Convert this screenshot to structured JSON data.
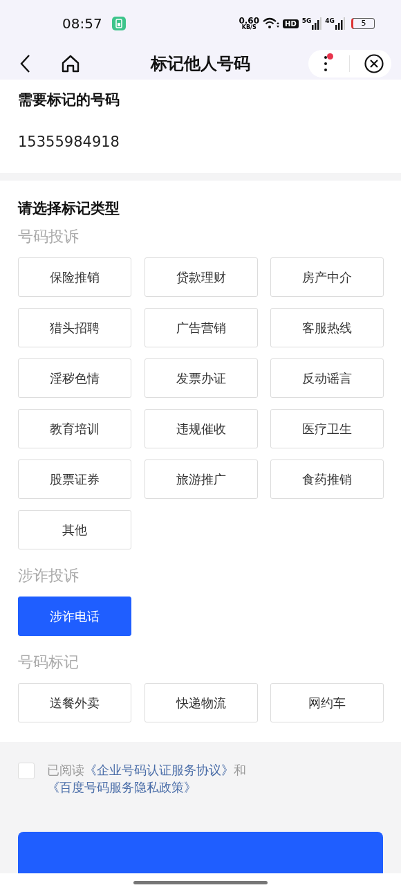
{
  "status_bar": {
    "time": "08:57",
    "net_speed": "0.60",
    "net_unit": "KB/S",
    "hd": "HD",
    "signal_1": "5G",
    "signal_2": "4G",
    "battery": "5"
  },
  "header": {
    "title": "标记他人号码",
    "menu_badge": true
  },
  "number_section": {
    "title": "需要标记的号码",
    "number": "15355984918"
  },
  "type_section": {
    "title": "请选择标记类型",
    "groups": [
      {
        "label": "号码投诉",
        "options": [
          {
            "label": "保险推销",
            "selected": false
          },
          {
            "label": "贷款理财",
            "selected": false
          },
          {
            "label": "房产中介",
            "selected": false
          },
          {
            "label": "猎头招聘",
            "selected": false
          },
          {
            "label": "广告营销",
            "selected": false
          },
          {
            "label": "客服热线",
            "selected": false
          },
          {
            "label": "淫秽色情",
            "selected": false
          },
          {
            "label": "发票办证",
            "selected": false
          },
          {
            "label": "反动谣言",
            "selected": false
          },
          {
            "label": "教育培训",
            "selected": false
          },
          {
            "label": "违规催收",
            "selected": false
          },
          {
            "label": "医疗卫生",
            "selected": false
          },
          {
            "label": "股票证券",
            "selected": false
          },
          {
            "label": "旅游推广",
            "selected": false
          },
          {
            "label": "食药推销",
            "selected": false
          },
          {
            "label": "其他",
            "selected": false
          }
        ]
      },
      {
        "label": "涉诈投诉",
        "options": [
          {
            "label": "涉诈电话",
            "selected": true
          }
        ]
      },
      {
        "label": "号码标记",
        "options": [
          {
            "label": "送餐外卖",
            "selected": false
          },
          {
            "label": "快递物流",
            "selected": false
          },
          {
            "label": "网约车",
            "selected": false
          }
        ]
      }
    ]
  },
  "agreement": {
    "checked": false,
    "parts": [
      {
        "kind": "text",
        "text": "已阅读"
      },
      {
        "kind": "link",
        "text": "《企业号码认证服务协议》"
      },
      {
        "kind": "text",
        "text": "和"
      },
      {
        "kind": "link",
        "text": "《百度号码服务隐私政策》"
      }
    ]
  }
}
